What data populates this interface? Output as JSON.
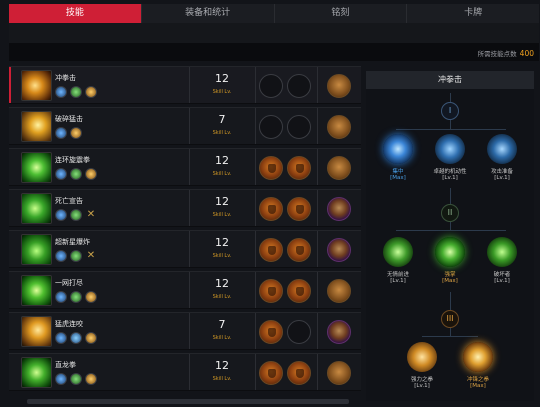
{
  "tabs": [
    "技能",
    "装备和统计",
    "铭刻",
    "卡牌"
  ],
  "points": {
    "label": "所需技能点数",
    "value": "400"
  },
  "skills": [
    {
      "name": "冲拳击",
      "level": "12",
      "unit": "Skill Lv.",
      "slots": [
        "empty",
        "empty"
      ],
      "rune": "bronze",
      "mods": [
        "blue",
        "green",
        "gold"
      ]
    },
    {
      "name": "破碎猛击",
      "level": "7",
      "unit": "Skill Lv.",
      "slots": [
        "empty",
        "empty"
      ],
      "rune": "bronze",
      "mods": [
        "blue",
        "gold"
      ]
    },
    {
      "name": "连环旋震拳",
      "level": "12",
      "unit": "Skill Lv.",
      "slots": [
        "fill",
        "fill"
      ],
      "rune": "bronze",
      "mods": [
        "blue",
        "green",
        "gold"
      ]
    },
    {
      "name": "死亡宣告",
      "level": "12",
      "unit": "Skill Lv.",
      "slots": [
        "fill",
        "fill"
      ],
      "rune": "purple",
      "mods": [
        "blue",
        "green",
        "x"
      ]
    },
    {
      "name": "超新星爆炸",
      "level": "12",
      "unit": "Skill Lv.",
      "slots": [
        "fill",
        "fill"
      ],
      "rune": "purple",
      "mods": [
        "blue",
        "green",
        "x"
      ]
    },
    {
      "name": "一网打尽",
      "level": "12",
      "unit": "Skill Lv.",
      "slots": [
        "fill",
        "fill"
      ],
      "rune": "bronze",
      "mods": [
        "blue",
        "green",
        "gold"
      ]
    },
    {
      "name": "猛虎连咬",
      "level": "7",
      "unit": "Skill Lv.",
      "slots": [
        "fill",
        "empty"
      ],
      "rune": "purple",
      "mods": [
        "blue",
        "blue",
        "gold"
      ]
    },
    {
      "name": "直龙拳",
      "level": "12",
      "unit": "Skill Lv.",
      "slots": [
        "fill",
        "fill"
      ],
      "rune": "bronze",
      "mods": [
        "blue",
        "green",
        "gold"
      ]
    }
  ],
  "tree": {
    "title": "冲拳击",
    "tiers": [
      "I",
      "II",
      "III"
    ],
    "tier1": [
      {
        "name": "集中",
        "level": "[Max]",
        "style": "hi"
      },
      {
        "name": "卓越的机动性",
        "level": "[Lv.1]",
        "style": ""
      },
      {
        "name": "攻击准备",
        "level": "[Lv.1]",
        "style": ""
      }
    ],
    "tier2": [
      {
        "name": "无情前进",
        "level": "[Lv.1]",
        "style": ""
      },
      {
        "name": "强掌",
        "level": "[Max]",
        "style": "gold"
      },
      {
        "name": "破坏者",
        "level": "[Lv.1]",
        "style": ""
      }
    ],
    "tier3": [
      {
        "name": "强力之拳",
        "level": "[Lv.1]",
        "style": ""
      },
      {
        "name": "冲锋之拳",
        "level": "[Max]",
        "style": "gold"
      }
    ]
  },
  "colors": {
    "accent": "#cf1f36",
    "gold": "#f0a11f",
    "blue": "#4aa0e8"
  }
}
